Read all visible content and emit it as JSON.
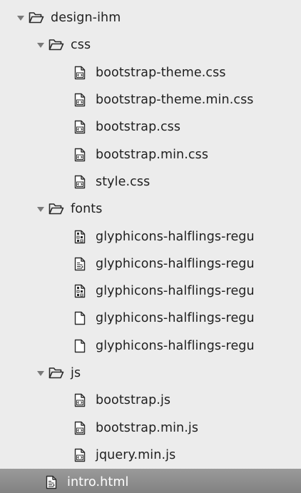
{
  "tree": {
    "root": {
      "label": "design-ihm",
      "icon": "folder-open-icon"
    },
    "css": {
      "label": "css",
      "files": [
        {
          "label": "bootstrap-theme.css",
          "icon": "code-file-icon"
        },
        {
          "label": "bootstrap-theme.min.css",
          "icon": "code-file-icon"
        },
        {
          "label": "bootstrap.css",
          "icon": "code-file-icon"
        },
        {
          "label": "bootstrap.min.css",
          "icon": "code-file-icon"
        },
        {
          "label": "style.css",
          "icon": "code-file-icon"
        }
      ]
    },
    "fonts": {
      "label": "fonts",
      "files": [
        {
          "label": "glyphicons-halflings-regu",
          "icon": "binary-file-icon"
        },
        {
          "label": "glyphicons-halflings-regu",
          "icon": "text-file-icon"
        },
        {
          "label": "glyphicons-halflings-regu",
          "icon": "binary-file-icon"
        },
        {
          "label": "glyphicons-halflings-regu",
          "icon": "blank-file-icon"
        },
        {
          "label": "glyphicons-halflings-regu",
          "icon": "blank-file-icon"
        }
      ]
    },
    "js": {
      "label": "js",
      "files": [
        {
          "label": "bootstrap.js",
          "icon": "code-file-icon"
        },
        {
          "label": "bootstrap.min.js",
          "icon": "code-file-icon"
        },
        {
          "label": "jquery.min.js",
          "icon": "code-file-icon"
        }
      ]
    },
    "selected_file": {
      "label": "intro.html",
      "icon": "text-file-icon"
    }
  },
  "colors": {
    "background": "#ececec",
    "selected_bg": "#8a8a8a",
    "text": "#1f1f1f",
    "selected_text": "#ffffff"
  }
}
